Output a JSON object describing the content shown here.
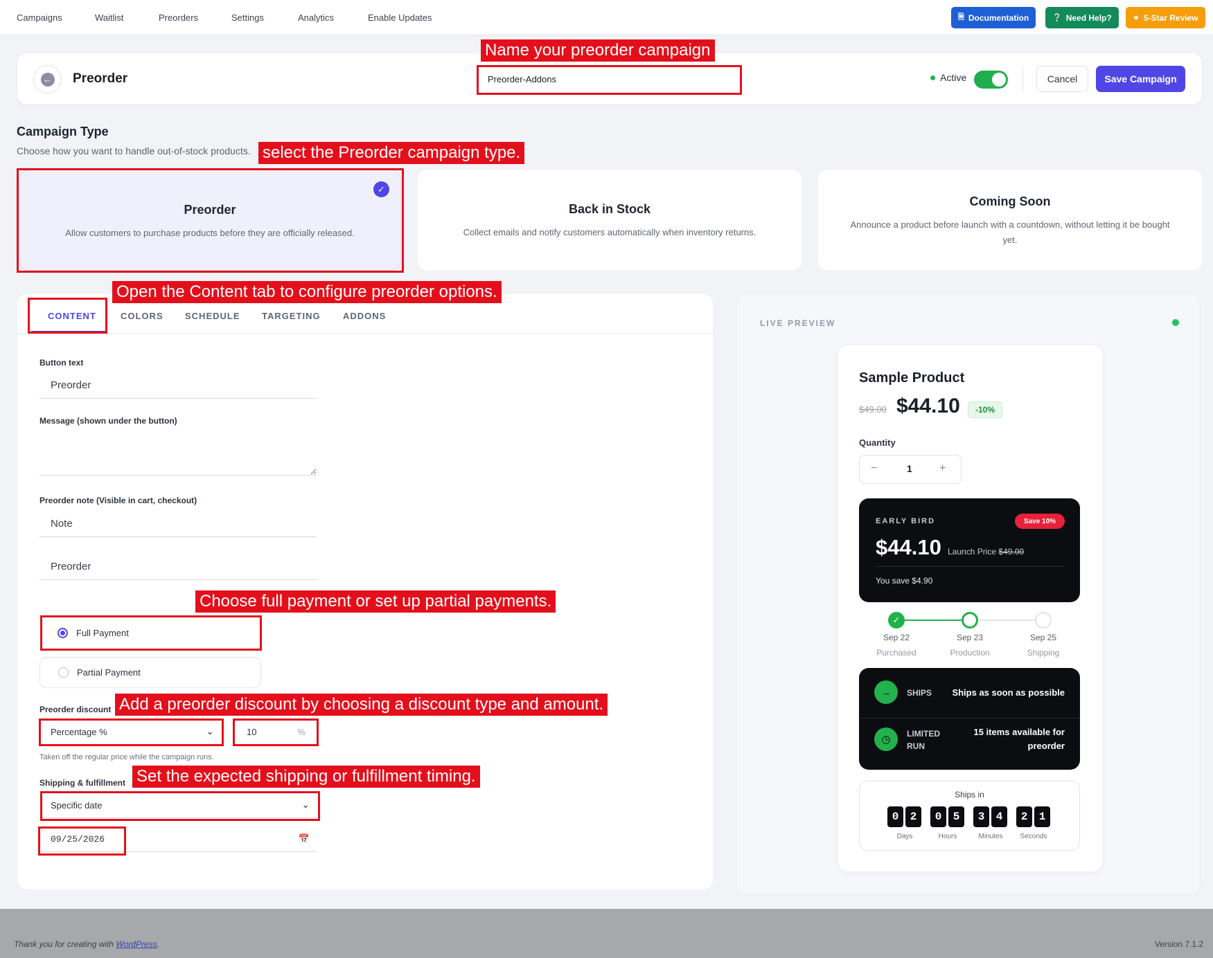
{
  "nav": {
    "items": [
      "Campaigns",
      "Waitlist",
      "Preorders",
      "Settings",
      "Analytics",
      "Enable Updates"
    ],
    "documentation": "Documentation",
    "need_help": "Need Help?",
    "review": "5-Star Review",
    "colors": {
      "documentation": "#1f5fd6",
      "need_help": "#138a5a",
      "review": "#f59e0b"
    }
  },
  "header": {
    "title": "Preorder",
    "campaign_name": "Preorder-Addons",
    "active_label": "Active",
    "active": true,
    "cancel": "Cancel",
    "save": "Save Campaign"
  },
  "campaign_type": {
    "title": "Campaign Type",
    "subtitle": "Choose how you want to handle out-of-stock products.",
    "options": [
      {
        "title": "Preorder",
        "description": "Allow customers to purchase products before they are officially released.",
        "selected": true
      },
      {
        "title": "Back in Stock",
        "description": "Collect emails and notify customers automatically when inventory returns.",
        "selected": false
      },
      {
        "title": "Coming Soon",
        "description": "Announce a product before launch with a countdown, without letting it be bought yet.",
        "selected": false
      }
    ]
  },
  "tabs": [
    "CONTENT",
    "COLORS",
    "SCHEDULE",
    "TARGETING",
    "ADDONS"
  ],
  "active_tab": "CONTENT",
  "form": {
    "button_text_label": "Button text",
    "button_text": "Preorder",
    "message_label": "Message (shown under the button)",
    "message": "",
    "note_label": "Preorder note (Visible in cart, checkout)",
    "note_value": "Note",
    "note_extra": "Preorder",
    "payment_options": [
      {
        "label": "Full Payment",
        "selected": true
      },
      {
        "label": "Partial Payment",
        "selected": false
      }
    ],
    "discount_label": "Preorder discount",
    "discount_type": "Percentage %",
    "discount_amount": "10",
    "discount_unit": "%",
    "discount_help": "Taken off the regular price while the campaign runs.",
    "shipping_label": "Shipping & fulfillment",
    "shipping_type": "Specific date",
    "shipping_date": "09/25/2026"
  },
  "annotations": {
    "name": "Name your preorder campaign",
    "type": "select the Preorder campaign type.",
    "content": "Open the Content tab to configure preorder options.",
    "payment": "Choose full payment or set up partial payments.",
    "discount": "Add a preorder discount by choosing a discount type and amount.",
    "shipping": "Set the expected shipping or fulfillment timing."
  },
  "preview": {
    "label": "LIVE PREVIEW",
    "product_name": "Sample Product",
    "old_price": "$49.00",
    "new_price": "$44.10",
    "discount_badge": "-10%",
    "quantity_label": "Quantity",
    "quantity": "1",
    "early_bird_label": "EARLY BIRD",
    "save_badge": "Save 10%",
    "eb_price": "$44.10",
    "launch_price_label": "Launch Price",
    "launch_price": "$49.00",
    "you_save": "You save $4.90",
    "timeline": [
      {
        "date": "Sep 22",
        "stage": "Purchased"
      },
      {
        "date": "Sep 23",
        "stage": "Production"
      },
      {
        "date": "Sep 25",
        "stage": "Shipping"
      }
    ],
    "ships_label": "SHIPS",
    "ships_value": "Ships as soon as possible",
    "limited_label_1": "LIMITED",
    "limited_label_2": "RUN",
    "limited_value_1": "15 items available for",
    "limited_value_2": "preorder",
    "countdown_label": "Ships in",
    "countdown": [
      {
        "digits": [
          "0",
          "2"
        ],
        "unit": "Days"
      },
      {
        "digits": [
          "0",
          "5"
        ],
        "unit": "Hours"
      },
      {
        "digits": [
          "3",
          "4"
        ],
        "unit": "Minutes"
      },
      {
        "digits": [
          "2",
          "1"
        ],
        "unit": "Seconds"
      }
    ],
    "accent": "#22b14c"
  },
  "footer": {
    "thanks_prefix": "Thank you for creating with",
    "wordpress": "WordPress",
    "thanks_suffix": ".",
    "version": "Version 7.1.2"
  }
}
